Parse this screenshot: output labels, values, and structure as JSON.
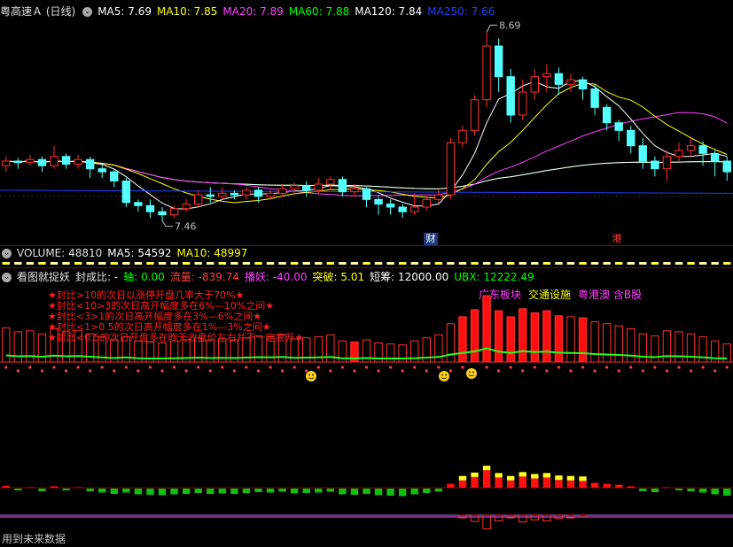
{
  "header": {
    "title": "粤高速Ａ (日线)",
    "ma5": "MA5: 7.69",
    "ma10": "MA10: 7.85",
    "ma20": "MA20: 7.89",
    "ma60": "MA60: 7.88",
    "ma120": "MA120: 7.84",
    "ma250": "MA250: 7.66",
    "colors": {
      "ma5": "#ffffff",
      "ma10": "#ffff00",
      "ma20": "#ff40ff",
      "ma60": "#00ff00",
      "ma120": "#ffffff",
      "ma250": "#2040ff"
    }
  },
  "price_labels": {
    "high": "8.69",
    "low": "7.46"
  },
  "markers": {
    "cai": "财",
    "gang": "港"
  },
  "volume_bar": {
    "label": "VOLUME: 48810",
    "ma5": "MA5: 54592",
    "ma10": "MA10: 48997"
  },
  "indicator_bar": {
    "name": "看图就捉妖",
    "fengchengbi": "封成比: -",
    "zhou": "轴: 0.00",
    "liuliang": "流量: -839.74",
    "boyao": "播妖: -40.00",
    "tupo": "突破: 5.01",
    "duanchou": "短筹: 12000.00",
    "ubx": "UBX: 12222.49"
  },
  "star_notes": [
    "★封比>10的次日以涨停开盘几率大于70%★",
    "★封比<10>3的次日高开幅度多在6%—10%之间★",
    "★封比<3>1的次日高开幅度多在3%—6%之间★",
    "★封比<1>0.5的次日高开幅度多在1%—3%之间★",
    "★封比<0.5的次日开盘多在昨天收盘价左右并不一定高开★"
  ],
  "concepts": {
    "c1": "广东板块",
    "c2": "交通设施",
    "c3": "粤港澳 含B股"
  },
  "footer": "用到未来数据",
  "chart_data": {
    "type": "candlestick",
    "y_range": [
      7.4,
      8.75
    ],
    "high_label": 8.69,
    "low_label": 7.46,
    "candles": [
      [
        7.82,
        7.85,
        7.78,
        7.88
      ],
      [
        7.85,
        7.84,
        7.8,
        7.87
      ],
      [
        7.84,
        7.86,
        7.82,
        7.89
      ],
      [
        7.86,
        7.82,
        7.78,
        7.88
      ],
      [
        7.82,
        7.88,
        7.8,
        7.95
      ],
      [
        7.88,
        7.83,
        7.8,
        7.9
      ],
      [
        7.83,
        7.86,
        7.8,
        7.89
      ],
      [
        7.86,
        7.8,
        7.74,
        7.88
      ],
      [
        7.8,
        7.78,
        7.74,
        7.83
      ],
      [
        7.78,
        7.72,
        7.68,
        7.8
      ],
      [
        7.72,
        7.58,
        7.55,
        7.74
      ],
      [
        7.58,
        7.56,
        7.52,
        7.6
      ],
      [
        7.56,
        7.52,
        7.48,
        7.6
      ],
      [
        7.52,
        7.5,
        7.46,
        7.55
      ],
      [
        7.5,
        7.54,
        7.48,
        7.56
      ],
      [
        7.54,
        7.57,
        7.52,
        7.6
      ],
      [
        7.57,
        7.63,
        7.55,
        7.66
      ],
      [
        7.63,
        7.62,
        7.58,
        7.68
      ],
      [
        7.62,
        7.64,
        7.6,
        7.68
      ],
      [
        7.64,
        7.63,
        7.6,
        7.66
      ],
      [
        7.63,
        7.66,
        7.6,
        7.68
      ],
      [
        7.66,
        7.62,
        7.58,
        7.68
      ],
      [
        7.62,
        7.64,
        7.6,
        7.66
      ],
      [
        7.64,
        7.67,
        7.62,
        7.7
      ],
      [
        7.67,
        7.69,
        7.64,
        7.71
      ],
      [
        7.69,
        7.66,
        7.62,
        7.72
      ],
      [
        7.66,
        7.7,
        7.64,
        7.74
      ],
      [
        7.7,
        7.73,
        7.66,
        7.75
      ],
      [
        7.73,
        7.65,
        7.62,
        7.75
      ],
      [
        7.65,
        7.67,
        7.62,
        7.7
      ],
      [
        7.67,
        7.6,
        7.55,
        7.68
      ],
      [
        7.6,
        7.57,
        7.5,
        7.62
      ],
      [
        7.57,
        7.55,
        7.5,
        7.6
      ],
      [
        7.55,
        7.52,
        7.48,
        7.57
      ],
      [
        7.52,
        7.55,
        7.5,
        7.64
      ],
      [
        7.55,
        7.6,
        7.53,
        7.62
      ],
      [
        7.6,
        7.63,
        7.58,
        7.67
      ],
      [
        7.63,
        7.97,
        7.6,
        8.0
      ],
      [
        7.97,
        8.05,
        7.94,
        8.08
      ],
      [
        8.05,
        8.25,
        8.02,
        8.28
      ],
      [
        8.25,
        8.6,
        8.2,
        8.69
      ],
      [
        8.6,
        8.4,
        8.3,
        8.65
      ],
      [
        8.4,
        8.15,
        8.1,
        8.45
      ],
      [
        8.15,
        8.3,
        8.12,
        8.38
      ],
      [
        8.3,
        8.4,
        8.25,
        8.45
      ],
      [
        8.4,
        8.42,
        8.3,
        8.48
      ],
      [
        8.42,
        8.35,
        8.28,
        8.46
      ],
      [
        8.35,
        8.38,
        8.3,
        8.42
      ],
      [
        8.38,
        8.32,
        8.25,
        8.4
      ],
      [
        8.32,
        8.2,
        8.15,
        8.35
      ],
      [
        8.2,
        8.1,
        8.05,
        8.22
      ],
      [
        8.1,
        8.05,
        7.98,
        8.12
      ],
      [
        8.05,
        7.95,
        7.9,
        8.08
      ],
      [
        7.95,
        7.85,
        7.8,
        8.0
      ],
      [
        7.85,
        7.8,
        7.75,
        7.88
      ],
      [
        7.8,
        7.88,
        7.72,
        7.92
      ],
      [
        7.88,
        7.92,
        7.85,
        7.97
      ],
      [
        7.92,
        7.95,
        7.88,
        8.0
      ],
      [
        7.95,
        7.9,
        7.82,
        7.98
      ],
      [
        7.9,
        7.85,
        7.75,
        7.92
      ],
      [
        7.85,
        7.78,
        7.72,
        7.88
      ]
    ],
    "volume": [
      34,
      30,
      31,
      28,
      33,
      30,
      31,
      28,
      25,
      22,
      25,
      21,
      20,
      19,
      21,
      22,
      24,
      22,
      23,
      22,
      24,
      26,
      25,
      27,
      23,
      24,
      25,
      27,
      21,
      20,
      22,
      19,
      18,
      17,
      21,
      24,
      27,
      38,
      45,
      52,
      66,
      51,
      45,
      53,
      49,
      51,
      46,
      45,
      44,
      40,
      38,
      36,
      33,
      28,
      26,
      31,
      30,
      28,
      25,
      21,
      18
    ]
  }
}
